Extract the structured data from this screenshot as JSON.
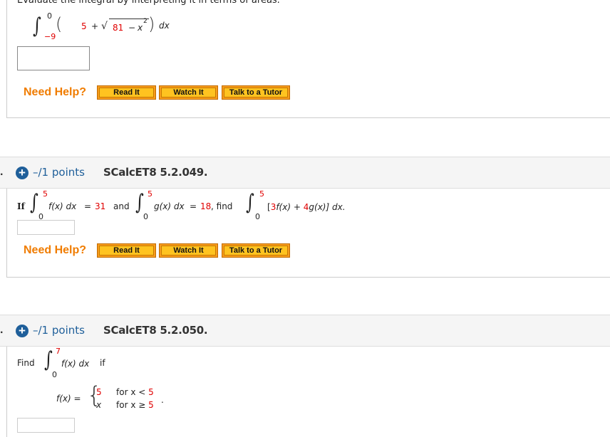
{
  "question_top": {
    "instruction": "Evaluate the integral by interpreting it in terms of areas.",
    "integral": {
      "upper": "0",
      "lower": "−9",
      "term_constant": "5",
      "plus": "+",
      "sqrt_radicand_number": "81",
      "sqrt_minus": "−",
      "sqrt_var": "x",
      "sqrt_exp": "2",
      "dx": "dx"
    },
    "answer_value": "",
    "need_help_label": "Need Help?",
    "buttons": {
      "read": "Read It",
      "watch": "Watch It",
      "tutor": "Talk to a Tutor"
    }
  },
  "question_049": {
    "bullet": ".",
    "points": "–/1 points",
    "id": "SCalcET8 5.2.049.",
    "text": {
      "if": "If",
      "f_integral": {
        "upper": "5",
        "lower": "0",
        "expr": "f(x) dx",
        "equals": "=",
        "value": "31"
      },
      "and": "and",
      "g_integral": {
        "upper": "5",
        "lower": "0",
        "expr": "g(x) dx",
        "equals": "=",
        "value": "18"
      },
      "comma_find": ", find",
      "target_integral": {
        "upper": "5",
        "lower": "0",
        "open": "[",
        "coef_f": "3",
        "f": "f(x)",
        "plus": "+",
        "coef_g": "4",
        "g": "g(x)",
        "close": "] dx."
      }
    },
    "answer_value": "",
    "need_help_label": "Need Help?",
    "buttons": {
      "read": "Read It",
      "watch": "Watch It",
      "tutor": "Talk to a Tutor"
    }
  },
  "question_050": {
    "bullet": ".",
    "points": "–/1 points",
    "id": "SCalcET8 5.2.050.",
    "text": {
      "find": "Find",
      "integral": {
        "upper": "7",
        "lower": "0",
        "expr": "f(x) dx",
        "if": "if"
      },
      "piecewise": {
        "lhs": "f(x) =",
        "case1_value": "5",
        "case1_cond": "for x <",
        "case1_bound": "5",
        "case2_value": "x",
        "case2_cond": "for x ≥",
        "case2_bound": "5",
        "period": "."
      }
    },
    "answer_value": ""
  },
  "colors": {
    "accent_blue": "#1f5f9a",
    "need_help_orange": "#f07c00",
    "button_fill": "#ffc320",
    "math_red": "#e00000"
  }
}
